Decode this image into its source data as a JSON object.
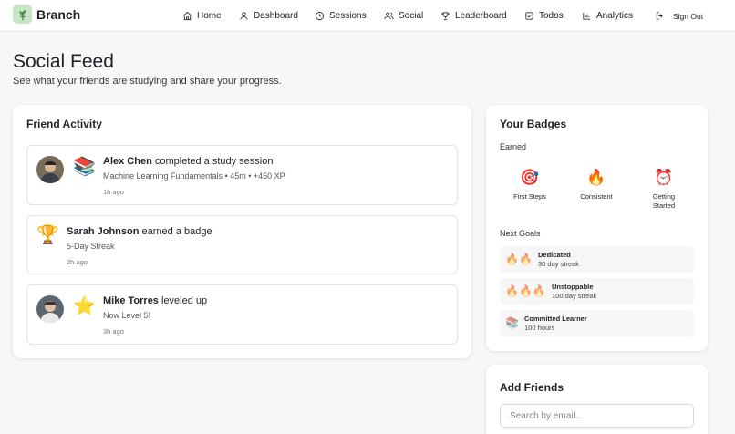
{
  "app": {
    "brand": "Branch",
    "logo_icon": "tree-icon",
    "accent": "#c9e4c6"
  },
  "nav": {
    "items": [
      {
        "label": "Home",
        "icon": "home-icon"
      },
      {
        "label": "Dashboard",
        "icon": "user-icon"
      },
      {
        "label": "Sessions",
        "icon": "clock-icon"
      },
      {
        "label": "Social",
        "icon": "users-icon"
      },
      {
        "label": "Leaderboard",
        "icon": "trophy-icon"
      },
      {
        "label": "Todos",
        "icon": "checkbox-icon"
      },
      {
        "label": "Analytics",
        "icon": "bar-chart-icon"
      }
    ],
    "signout": {
      "label": "Sign Out",
      "icon": "logout-icon"
    }
  },
  "page": {
    "title": "Social Feed",
    "subtitle": "See what your friends are studying and share your progress."
  },
  "activity": {
    "title": "Friend Activity",
    "items": [
      {
        "user": "Alex Chen",
        "action": " completed a study session",
        "detail": "Machine Learning Fundamentals • 45m • +450 XP",
        "time": "1h ago",
        "emoji": "📚",
        "has_avatar": true
      },
      {
        "user": "Sarah Johnson",
        "action": " earned a badge",
        "detail": "5-Day Streak",
        "time": "2h ago",
        "emoji": "🏆",
        "has_avatar": false
      },
      {
        "user": "Mike Torres",
        "action": " leveled up",
        "detail": "Now Level 5!",
        "time": "3h ago",
        "emoji": "⭐",
        "has_avatar": true
      }
    ]
  },
  "badges": {
    "title": "Your Badges",
    "earned_label": "Earned",
    "earned": [
      {
        "emoji": "🎯",
        "label": "First Steps"
      },
      {
        "emoji": "🔥",
        "label": "Consistent"
      },
      {
        "emoji": "⏰",
        "label": "Getting Started"
      }
    ],
    "next_label": "Next Goals",
    "next": [
      {
        "icons": "🔥🔥",
        "name": "Dedicated",
        "desc": "30 day streak"
      },
      {
        "icons": "🔥🔥🔥",
        "name": "Unstoppable",
        "desc": "100 day streak"
      },
      {
        "icons": "📚",
        "name": "Committed Learner",
        "desc": "100 hours"
      }
    ]
  },
  "friends": {
    "title": "Add Friends",
    "search_placeholder": "Search by email..."
  }
}
